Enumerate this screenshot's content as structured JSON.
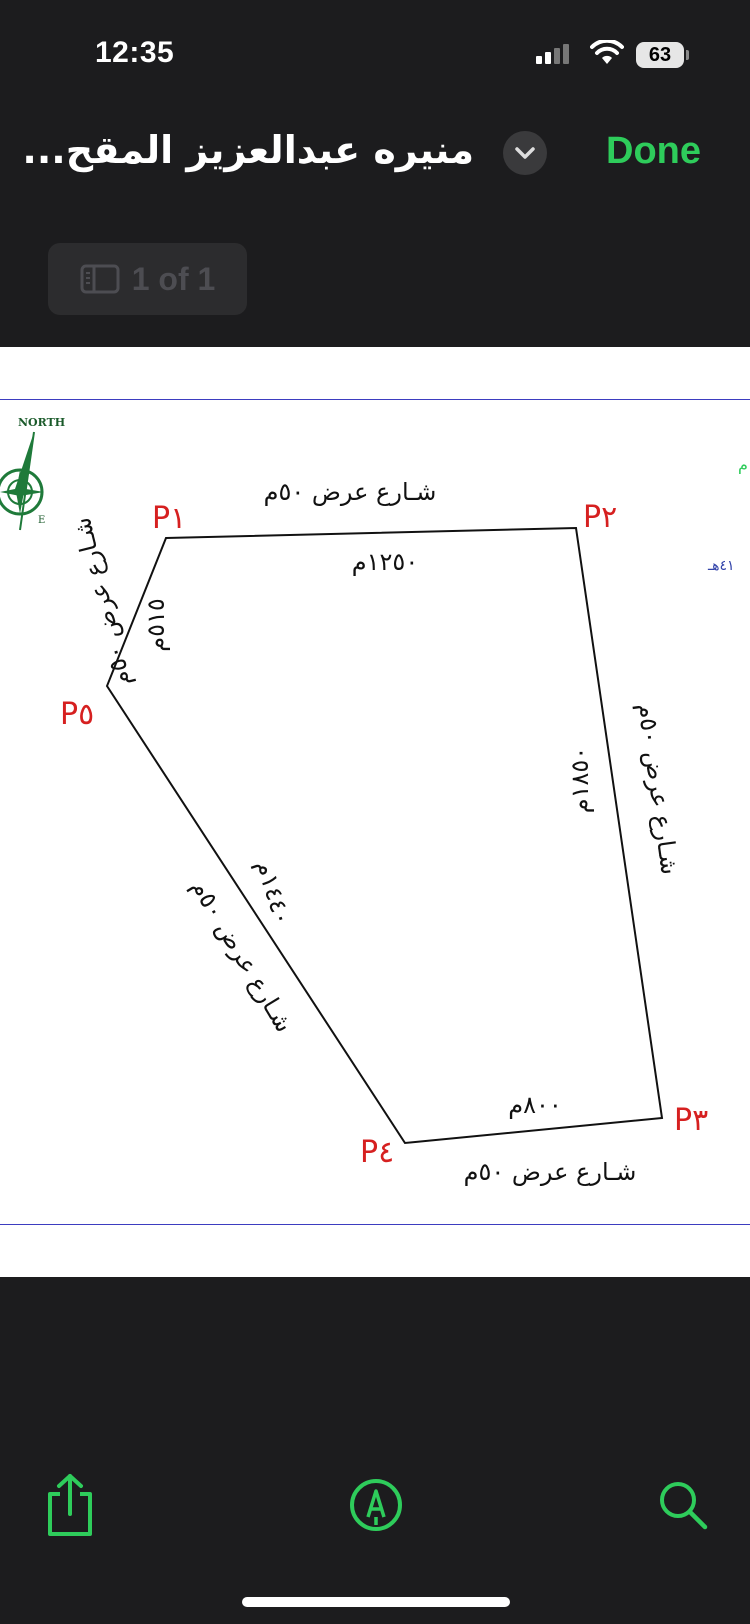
{
  "status": {
    "time": "12:35",
    "battery": "63"
  },
  "nav": {
    "title": "منيره عبدالعزيز المقح...",
    "done_label": "Done"
  },
  "page_indicator": {
    "label": "1 of 1"
  },
  "plan": {
    "north_label": "NORTH",
    "east_label": "E",
    "points": {
      "p1": "P١",
      "p2": "P٢",
      "p3": "P٣",
      "p4": "P٤",
      "p5": "P٥"
    },
    "streets": {
      "top": "شـارع عرض ٥٠م",
      "bottom": "شـارع عرض ٥٠م",
      "left": "شـارع عرض ٥٠م",
      "right": "شـارع عرض ٥٠م",
      "diag": "شـارع عرض ٥٠م"
    },
    "lengths": {
      "top": "١٢٥٠م",
      "left": "٥١٥م",
      "right": "١٨٥٠م",
      "bottom": "٨٠٠م",
      "diag": "١٤٤٠م"
    },
    "edge_text_top": "م",
    "edge_text_side": "٤١هـ"
  },
  "toolbar": {
    "share": "share-icon",
    "markup": "markup-icon",
    "search": "search-icon"
  },
  "colors": {
    "accent": "#2ecc5b",
    "point_label": "#d62020"
  }
}
